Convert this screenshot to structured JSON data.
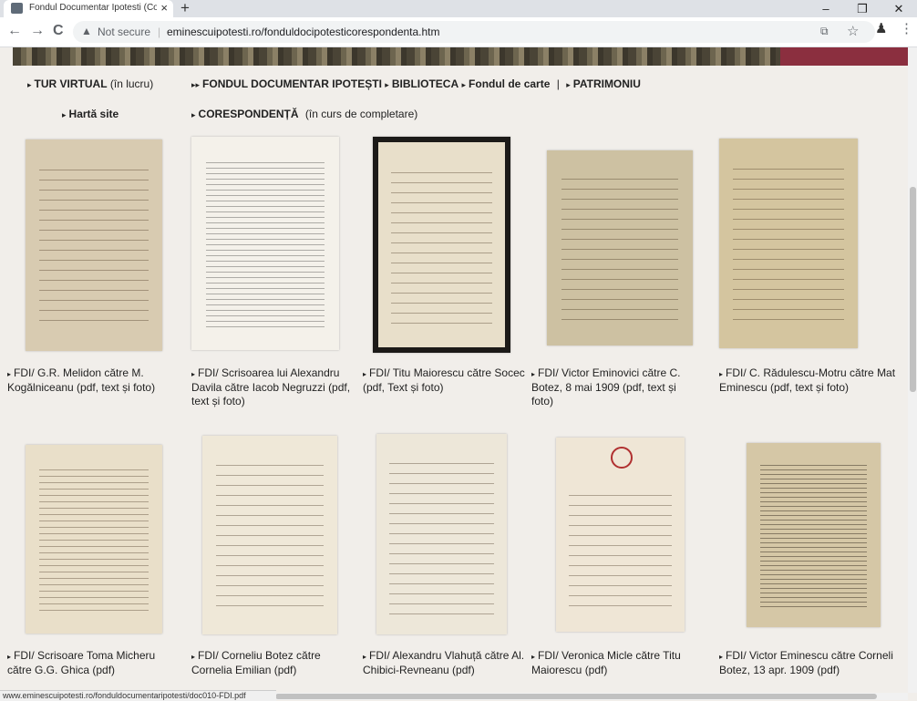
{
  "browser": {
    "tab_title": "Fondul Documentar Ipotesti (Co",
    "close": "×",
    "new_tab": "+",
    "minimize": "–",
    "maximize": "❐",
    "close_window": "✕",
    "back": "←",
    "forward": "→",
    "reload": "C",
    "warning_glyph": "▲",
    "not_secure": "Not secure",
    "sep": "|",
    "url": "eminescuipotesti.ro/fonduldocipotesticorespondenta.htm",
    "translate_glyph": "⧉",
    "star_glyph": "☆",
    "ext_glyph": "♟",
    "menu_glyph": "⋮"
  },
  "nav": {
    "tur_virtual": "TUR VIRTUAL",
    "tur_virtual_note": "(în lucru)",
    "fondul": "FONDUL DOCUMENTAR IPOTEȘTI",
    "biblioteca": "BIBLIOTECA",
    "fondul_carte": "Fondul de carte",
    "divider": "|",
    "patrimoniu": "PATRIMONIU",
    "harta": "Hartă site",
    "corespondenta": "CORESPONDENȚĂ",
    "corespondenta_note": "(în curs de completare)"
  },
  "documents": [
    {
      "caption": "FDI/ G.R. Melidon către M. Kogălniceanu (pdf, text și foto)"
    },
    {
      "caption": "FDI/ Scrisoarea lui Alexandru Davila către Iacob Negruzzi (pdf, text și foto)"
    },
    {
      "caption": "FDI/ Titu Maiorescu către Socec (pdf, Text și foto)"
    },
    {
      "caption": "FDI/ Victor Eminovici către  C. Botez, 8 mai 1909 (pdf, text și foto)"
    },
    {
      "caption": "FDI/ C. Rădulescu-Motru către Mat Eminescu (pdf, text și foto)"
    },
    {
      "caption": "FDI/ Scrisoare Toma Micheru către G.G. Ghica (pdf)"
    },
    {
      "caption": "FDI/ Corneliu Botez către Cornelia Emilian (pdf)"
    },
    {
      "caption": "FDI/ Alexandru Vlahuță către Al. Chibici-Revneanu (pdf)"
    },
    {
      "caption": "FDI/ Veronica Micle către Titu Maiorescu (pdf)"
    },
    {
      "caption": "FDI/ Victor Eminescu către Corneli Botez, 13 apr. 1909  (pdf)"
    }
  ],
  "status_bar": "www.eminescuipotesti.ro/fonduldocumentaripotesti/doc010-FDI.pdf",
  "colors": {
    "page_bg": "#f1eeea",
    "banner_accent": "#8b2f3f"
  }
}
